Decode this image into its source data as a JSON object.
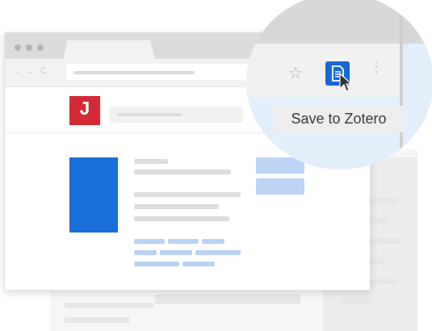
{
  "browser": {
    "nav_back": "←",
    "nav_forward": "→",
    "nav_reload": "C"
  },
  "site": {
    "logo_text": "J"
  },
  "extension": {
    "star_icon": "☆",
    "kebab_icon": "⋮",
    "tooltip": "Save to Zotero"
  },
  "colors": {
    "accent": "#1667d4",
    "logo": "#d42a35",
    "magnifier_bg": "#e3eefb"
  }
}
